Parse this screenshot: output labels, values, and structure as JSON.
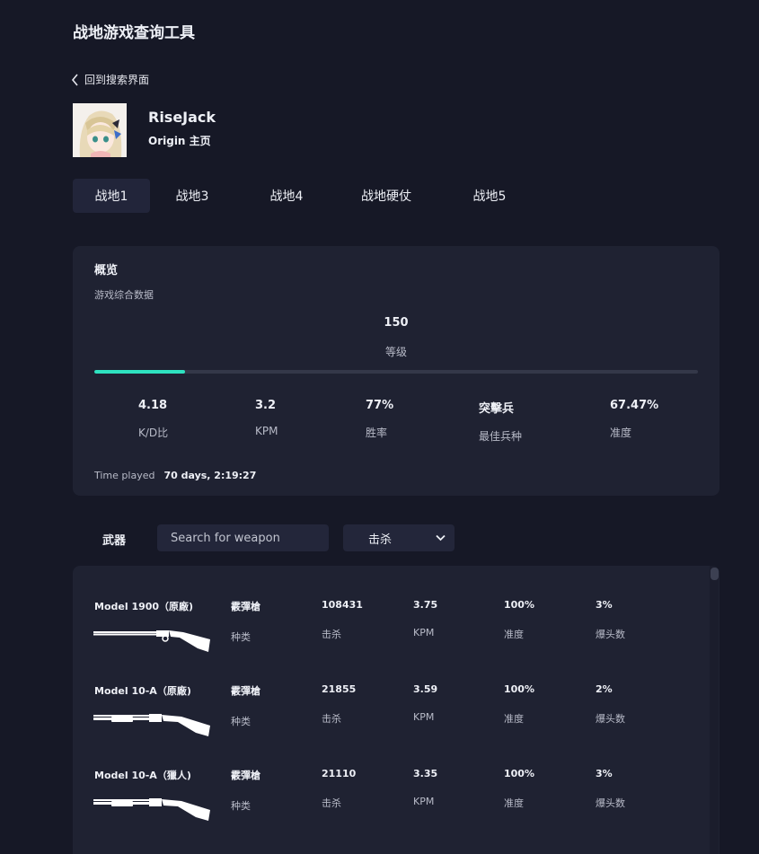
{
  "app": {
    "title": "战地游戏查询工具"
  },
  "nav": {
    "back_label": "回到搜索界面"
  },
  "profile": {
    "name": "RiseJack",
    "origin_label": "Origin 主页"
  },
  "tabs": [
    {
      "label": "战地1",
      "active": true
    },
    {
      "label": "战地3",
      "active": false
    },
    {
      "label": "战地4",
      "active": false
    },
    {
      "label": "战地硬仗",
      "active": false
    },
    {
      "label": "战地5",
      "active": false
    }
  ],
  "overview": {
    "title": "概览",
    "subtitle": "游戏综合数据",
    "level": {
      "value": "150",
      "label": "等级",
      "progress_fraction": 0.15
    },
    "accent_color": "#2ee2c0",
    "stats": [
      {
        "value": "4.18",
        "label": "K/D比"
      },
      {
        "value": "3.2",
        "label": "KPM"
      },
      {
        "value": "77%",
        "label": "胜率"
      },
      {
        "value": "突擊兵",
        "label": "最佳兵种"
      },
      {
        "value": "67.47%",
        "label": "准度"
      }
    ],
    "time_played": {
      "label": "Time played",
      "value": "70 days, 2:19:27"
    }
  },
  "weapons": {
    "label": "武器",
    "search_placeholder": "Search for weapon",
    "sort_value": "击杀",
    "items": [
      {
        "name": "Model 1900（原廠)",
        "type": "霰彈槍",
        "type_label": "种类",
        "kills": "108431",
        "kills_label": "击杀",
        "kpm": "3.75",
        "kpm_label": "KPM",
        "accuracy": "100%",
        "accuracy_label": "准度",
        "headshots": "3%",
        "headshots_label": "爆头数",
        "icon": "double-barrel-shotgun-icon"
      },
      {
        "name": "Model 10-A（原廠)",
        "type": "霰彈槍",
        "type_label": "种类",
        "kills": "21855",
        "kills_label": "击杀",
        "kpm": "3.59",
        "kpm_label": "KPM",
        "accuracy": "100%",
        "accuracy_label": "准度",
        "headshots": "2%",
        "headshots_label": "爆头数",
        "icon": "pump-shotgun-icon"
      },
      {
        "name": "Model 10-A（獵人)",
        "type": "霰彈槍",
        "type_label": "种类",
        "kills": "21110",
        "kills_label": "击杀",
        "kpm": "3.35",
        "kpm_label": "KPM",
        "accuracy": "100%",
        "accuracy_label": "准度",
        "headshots": "3%",
        "headshots_label": "爆头数",
        "icon": "pump-shotgun-icon"
      }
    ]
  }
}
